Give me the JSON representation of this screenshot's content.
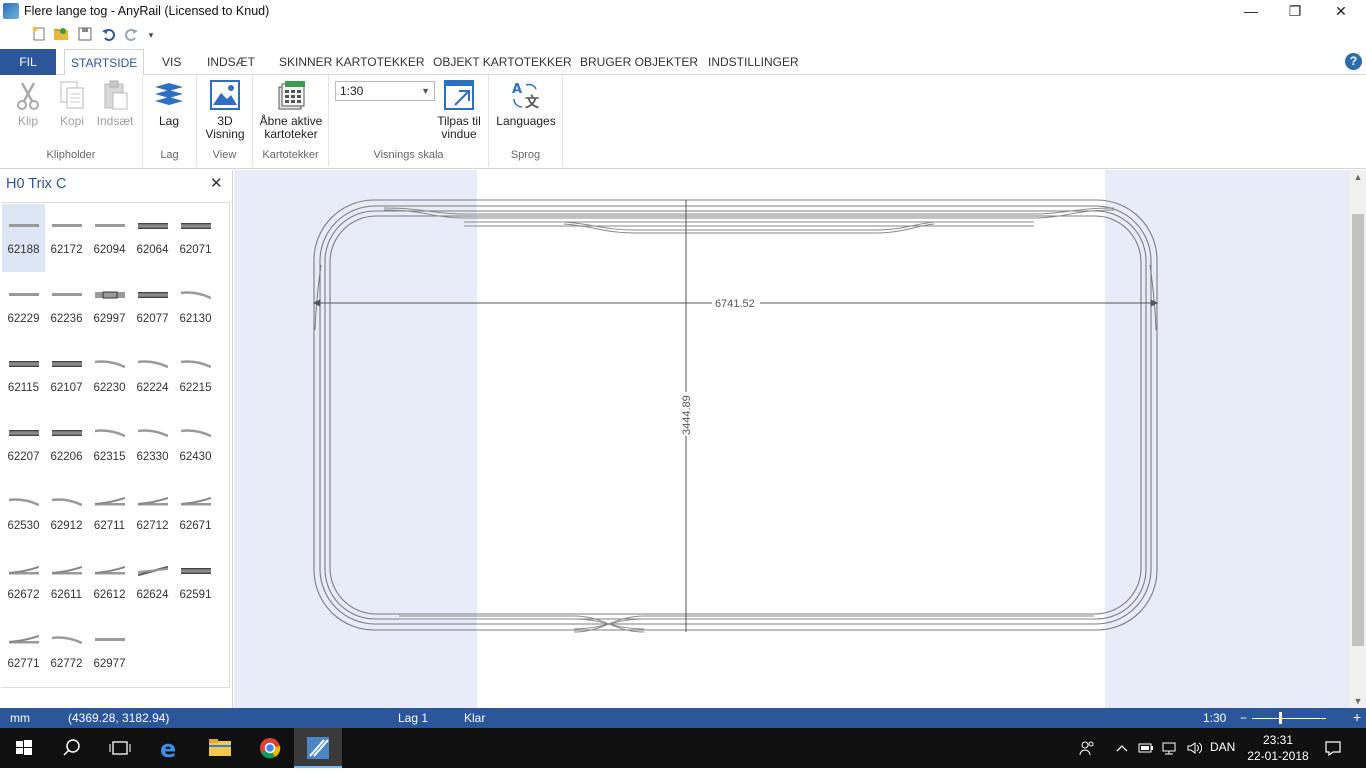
{
  "window": {
    "title": "Flere lange tog - AnyRail (Licensed to Knud)",
    "minimize": "—",
    "restore": "❐",
    "close": "✕"
  },
  "tabs": {
    "fil": "FIL",
    "items": [
      "STARTSIDE",
      "VIS",
      "INDSÆT",
      "SKINNER KARTOTEKKER",
      "OBJEKT KARTOTEKKER",
      "BRUGER OBJEKTER",
      "INDSTILLINGER"
    ],
    "active": "STARTSIDE",
    "help": "?"
  },
  "ribbon": {
    "klip": "Klip",
    "kopi": "Kopi",
    "indsaet": "Indsæt",
    "group_klipholder": "Klipholder",
    "lag": "Lag",
    "group_lag": "Lag",
    "visning_3d_line1": "3D",
    "visning_3d_line2": "Visning",
    "group_view": "View",
    "abne_line1": "Åbne aktive",
    "abne_line2": "kartoteker",
    "group_kartotekker": "Kartotekker",
    "scale_value": "1:30",
    "tilpas_line1": "Tilpas til",
    "tilpas_line2": "vindue",
    "group_visnings_skala": "Visnings skala",
    "languages": "Languages",
    "group_sprog": "Sprog"
  },
  "panel": {
    "title": "H0 Trix C",
    "close": "✕",
    "items": [
      "62188",
      "62172",
      "62094",
      "62064",
      "62071",
      "62229",
      "62236",
      "62997",
      "62077",
      "62130",
      "62115",
      "62107",
      "62230",
      "62224",
      "62215",
      "62207",
      "62206",
      "62315",
      "62330",
      "62430",
      "62530",
      "62912",
      "62711",
      "62712",
      "62671",
      "62672",
      "62611",
      "62612",
      "62624",
      "62591",
      "62771",
      "62772",
      "62977"
    ],
    "selected": "62188"
  },
  "canvas": {
    "dim_horizontal": "6741.52",
    "dim_vertical": "3444.89"
  },
  "status": {
    "unit": "mm",
    "coords": "(4369.28, 3182.94)",
    "layer": "Lag 1",
    "state": "Klar",
    "scale": "1:30",
    "zoom_minus": "−",
    "zoom_plus": "+"
  },
  "taskbar": {
    "lang": "DAN",
    "time": "23:31",
    "date": "22-01-2018"
  },
  "colors": {
    "accent": "#2b579a",
    "canvas_bg": "#e7ecf8",
    "track": "#7a7a7a"
  }
}
